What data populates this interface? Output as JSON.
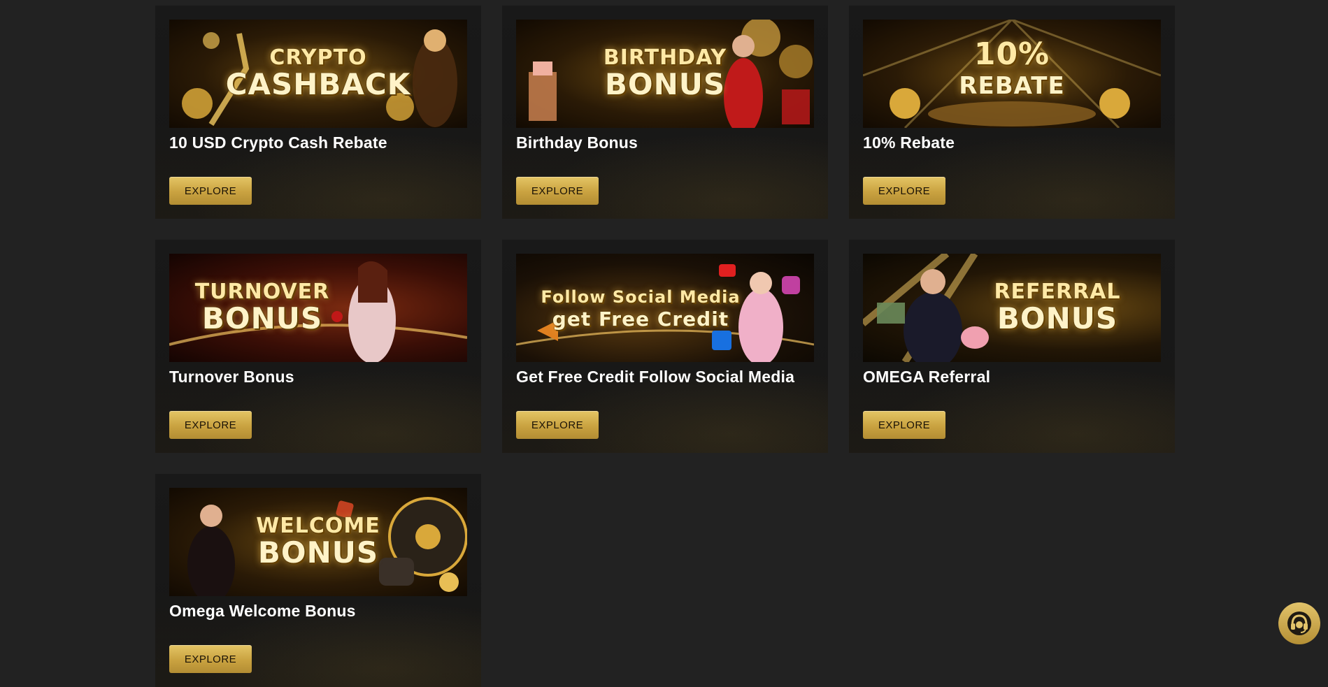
{
  "promotions": [
    {
      "title": "10 USD Crypto Cash Rebate",
      "banner_line1": "CRYPTO",
      "banner_line2": "CASHBACK",
      "cta": "EXPLORE"
    },
    {
      "title": "Birthday Bonus",
      "banner_line1": "BIRTHDAY",
      "banner_line2": "BONUS",
      "cta": "EXPLORE"
    },
    {
      "title": "10% Rebate",
      "banner_line1": "10%",
      "banner_line2": "REBATE",
      "cta": "EXPLORE"
    },
    {
      "title": "Turnover Bonus",
      "banner_line1": "TURNOVER",
      "banner_line2": "BONUS",
      "cta": "EXPLORE"
    },
    {
      "title": "Get Free Credit Follow Social Media",
      "banner_line1": "Follow Social Media",
      "banner_line2": "get Free Credit",
      "cta": "EXPLORE"
    },
    {
      "title": "OMEGA Referral",
      "banner_line1": "REFERRAL",
      "banner_line2": "BONUS",
      "cta": "EXPLORE"
    },
    {
      "title": "Omega Welcome Bonus",
      "banner_line1": "WELCOME",
      "banner_line2": "BONUS",
      "cta": "EXPLORE"
    }
  ],
  "colors": {
    "page_bg": "#222222",
    "card_bg": "#191919",
    "accent_gold": "#c9a240",
    "title_text": "#ffffff"
  },
  "support_widget": {
    "icon": "headset-icon"
  }
}
